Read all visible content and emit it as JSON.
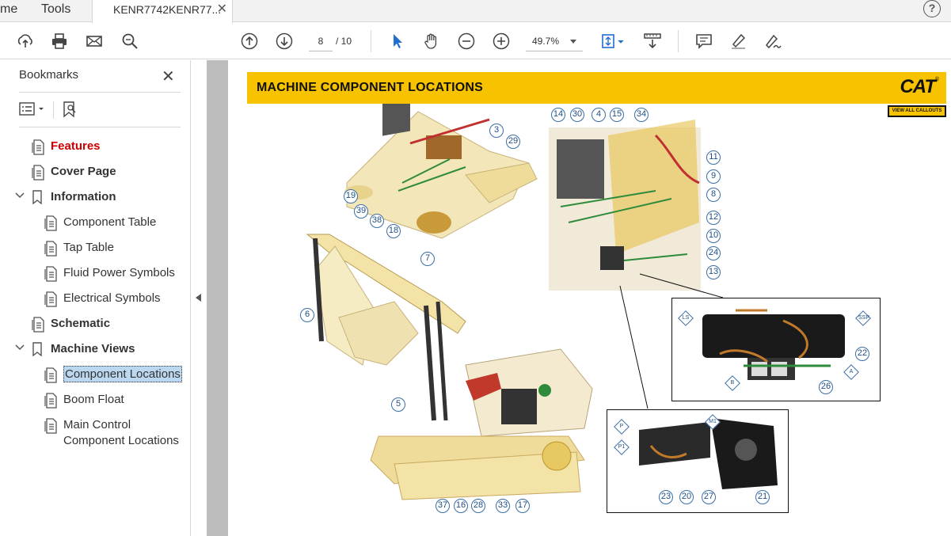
{
  "tabs": {
    "home": "me",
    "tools": "Tools",
    "document": "KENR7742KENR77..."
  },
  "toolbar": {
    "page_current": "8",
    "page_total": "/ 10",
    "zoom": "49.7%"
  },
  "sidebar": {
    "title": "Bookmarks",
    "items": [
      {
        "label": "Features"
      },
      {
        "label": "Cover Page"
      },
      {
        "label": "Information"
      },
      {
        "label": "Component Table"
      },
      {
        "label": "Tap Table"
      },
      {
        "label": "Fluid Power Symbols"
      },
      {
        "label": "Electrical Symbols"
      },
      {
        "label": "Schematic"
      },
      {
        "label": "Machine Views"
      },
      {
        "label": "Component Locations"
      },
      {
        "label": "Boom Float"
      },
      {
        "label": "Main Control",
        "label2": "Component Locations"
      }
    ]
  },
  "document": {
    "title": "MACHINE COMPONENT LOCATIONS",
    "logo": "CAT",
    "logo_reg": "®",
    "callouts_button": "VIEW ALL CALLOUTS",
    "callouts": [
      "3",
      "29",
      "19",
      "39",
      "38",
      "18",
      "7",
      "6",
      "5",
      "37",
      "16",
      "28",
      "33",
      "17",
      "14",
      "30",
      "4",
      "15",
      "34",
      "11",
      "9",
      "8",
      "12",
      "10",
      "24",
      "13",
      "22",
      "26",
      "23",
      "20",
      "27",
      "21"
    ],
    "ports": [
      "LS",
      "SSP",
      "B",
      "A",
      "P",
      "P1",
      "M1"
    ]
  },
  "colors": {
    "accent_yellow": "#f7c300",
    "callout_blue": "#1f4e85",
    "features_red": "#d00000",
    "selection": "#bcd7f0"
  }
}
